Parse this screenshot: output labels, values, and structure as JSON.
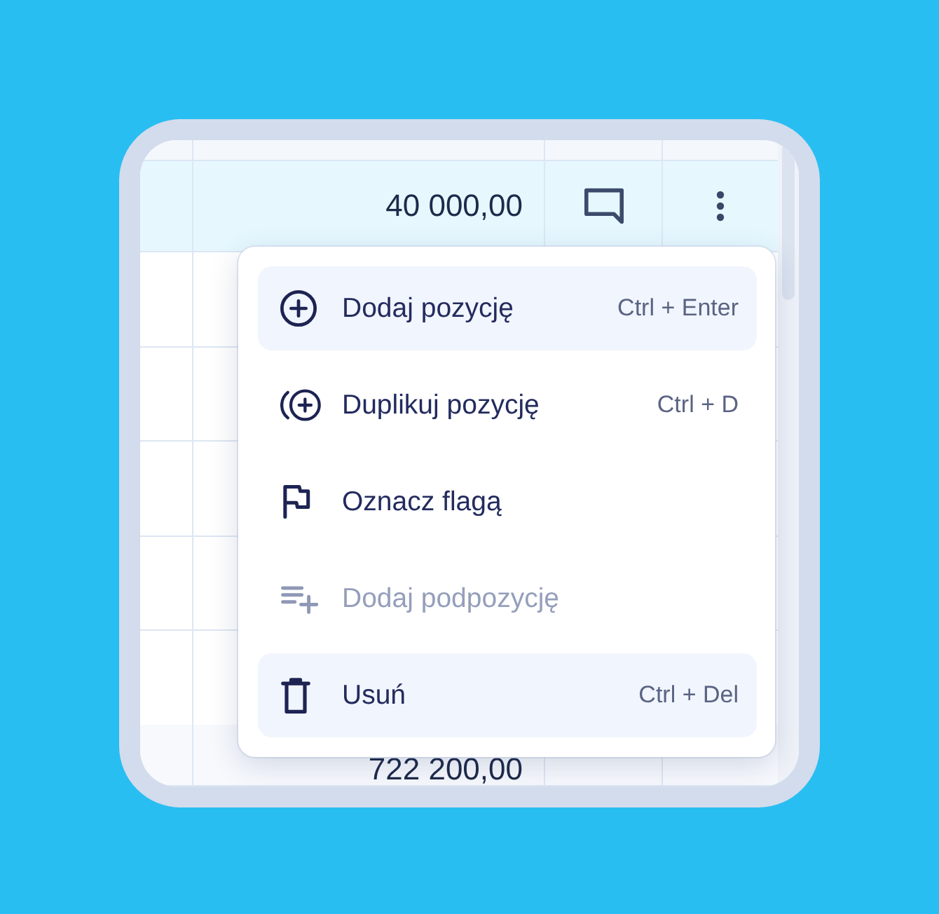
{
  "table": {
    "rows": [
      {
        "amount": "40 000,00",
        "selected": true,
        "actions": true
      },
      {
        "amount": "722 200,00",
        "selected": false,
        "actions": false
      }
    ]
  },
  "menu": {
    "items": [
      {
        "kind": "add",
        "label": "Dodaj pozycję",
        "shortcut": "Ctrl + Enter",
        "highlighted": true,
        "disabled": false
      },
      {
        "kind": "duplicate",
        "label": "Duplikuj pozycję",
        "shortcut": "Ctrl + D",
        "highlighted": false,
        "disabled": false
      },
      {
        "kind": "flag",
        "label": "Oznacz flagą",
        "highlighted": false,
        "disabled": false
      },
      {
        "kind": "subitem",
        "label": "Dodaj podpozycję",
        "highlighted": false,
        "disabled": true
      },
      {
        "kind": "delete",
        "label": "Usuń",
        "shortcut": "Ctrl + Del",
        "highlighted": true,
        "disabled": false
      }
    ]
  }
}
